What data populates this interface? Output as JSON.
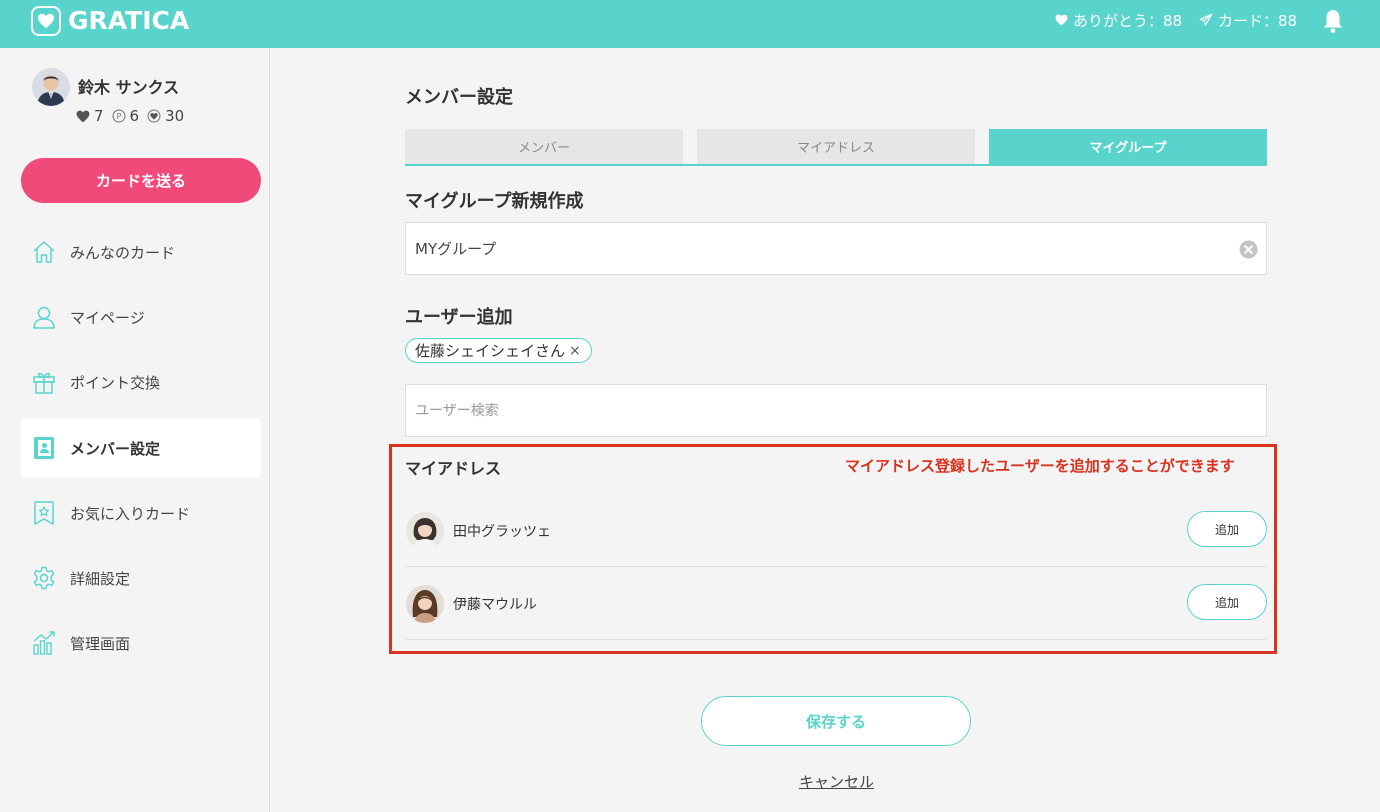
{
  "header": {
    "logo_text": "GRATICA",
    "thanks_label": "ありがとう：88",
    "cards_label": "カード：88",
    "brand_color": "#59d4cc"
  },
  "sidebar": {
    "user_name": "鈴木 サンクス",
    "stats": {
      "hearts": "7",
      "points": "6",
      "badges": "30"
    },
    "send_card_label": "カードを送る",
    "nav": [
      {
        "label": "みんなのカード",
        "icon": "home-icon"
      },
      {
        "label": "マイページ",
        "icon": "user-icon"
      },
      {
        "label": "ポイント交換",
        "icon": "gift-icon"
      },
      {
        "label": "メンバー設定",
        "icon": "address-book-icon",
        "active": true
      },
      {
        "label": "お気に入りカード",
        "icon": "bookmark-star-icon"
      },
      {
        "label": "詳細設定",
        "icon": "gear-icon"
      },
      {
        "label": "管理画面",
        "icon": "chart-icon"
      }
    ]
  },
  "main": {
    "page_title": "メンバー設定",
    "tabs": [
      {
        "label": "メンバー"
      },
      {
        "label": "マイアドレス"
      },
      {
        "label": "マイグループ",
        "active": true
      }
    ],
    "group_section_title": "マイグループ新規作成",
    "group_name_value": "MYグループ",
    "user_add_title": "ユーザー追加",
    "selected_user_chip": "佐藤シェイシェイさん",
    "chip_remove": "×",
    "user_search_placeholder": "ユーザー検索",
    "address_title": "マイアドレス",
    "annotation": "マイアドレス登録したユーザーを追加することができます",
    "address_list": [
      {
        "name": "田中グラッツェ",
        "button": "追加"
      },
      {
        "name": "伊藤マウルル",
        "button": "追加"
      }
    ],
    "save_label": "保存する",
    "cancel_label": "キャンセル"
  }
}
